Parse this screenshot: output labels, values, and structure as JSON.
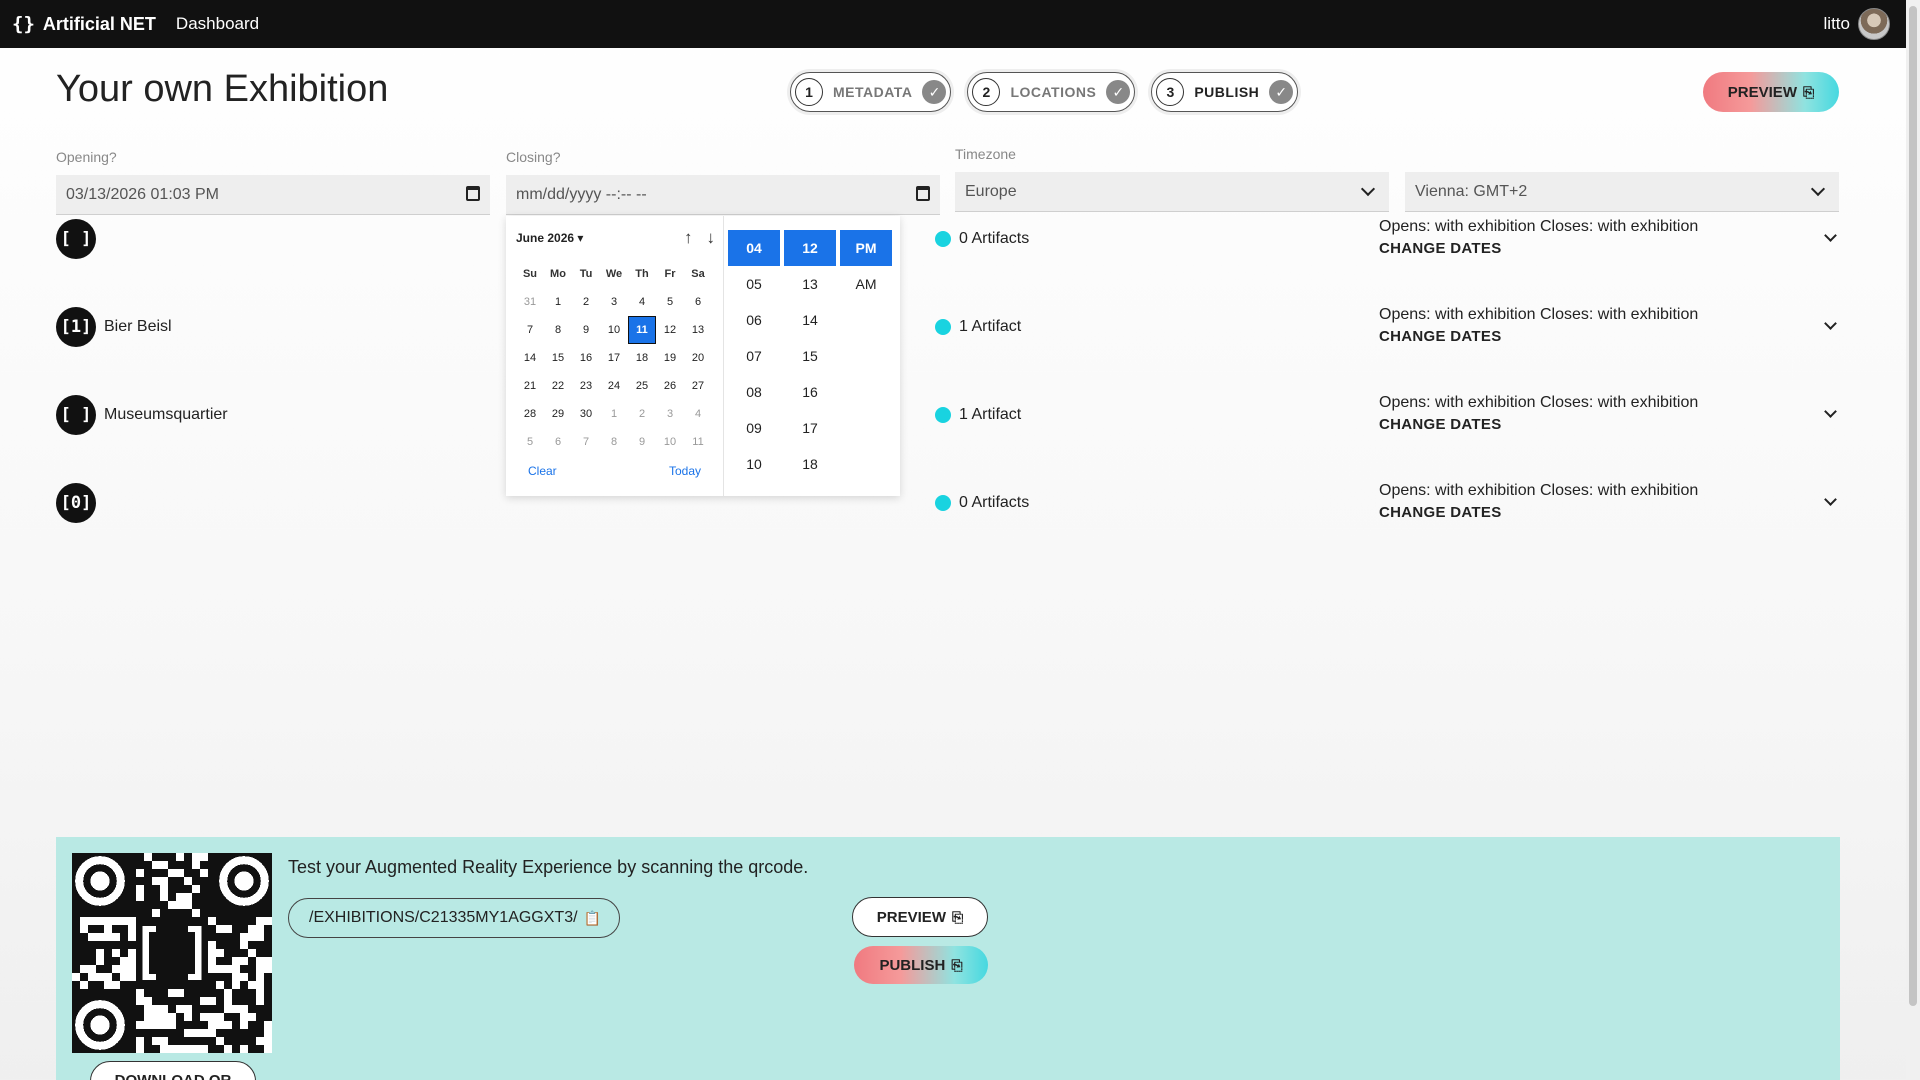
{
  "topbar": {
    "brand_logo": "{}",
    "brand_name": "Artificial NET",
    "nav_dashboard": "Dashboard",
    "username": "litto"
  },
  "page": {
    "title": "Your own Exhibition"
  },
  "stepper": [
    {
      "num": "1",
      "label": "METADATA"
    },
    {
      "num": "2",
      "label": "LOCATIONS"
    },
    {
      "num": "3",
      "label": "PUBLISH"
    }
  ],
  "preview_label": "PREVIEW",
  "opening": {
    "label": "Opening?",
    "value": "03/13/2026 01:03 PM"
  },
  "closing": {
    "label": "Closing?",
    "value": "mm/dd/yyyy --:-- --"
  },
  "timezone": {
    "label": "Timezone",
    "region": "Europe",
    "city": "Vienna: GMT+2"
  },
  "datepicker": {
    "month_label": "June 2026",
    "weekdays": [
      "Su",
      "Mo",
      "Tu",
      "We",
      "Th",
      "Fr",
      "Sa"
    ],
    "days": [
      "31",
      "1",
      "2",
      "3",
      "4",
      "5",
      "6",
      "7",
      "8",
      "9",
      "10",
      "11",
      "12",
      "13",
      "14",
      "15",
      "16",
      "17",
      "18",
      "19",
      "20",
      "21",
      "22",
      "23",
      "24",
      "25",
      "26",
      "27",
      "28",
      "29",
      "30",
      "1",
      "2",
      "3",
      "4",
      "5",
      "6",
      "7",
      "8",
      "9",
      "10",
      "11"
    ],
    "selected_day": "11",
    "clear": "Clear",
    "today": "Today",
    "hours": [
      "04",
      "05",
      "06",
      "07",
      "08",
      "09",
      "10"
    ],
    "minutes": [
      "12",
      "13",
      "14",
      "15",
      "16",
      "17",
      "18"
    ],
    "ampm": [
      "PM",
      "AM"
    ]
  },
  "locations": [
    {
      "icon": "[ ]",
      "name": "",
      "artifacts": "0 Artifacts",
      "dates": "Opens: with exhibition Closes: with exhibition",
      "change": "CHANGE DATES"
    },
    {
      "icon": "[1]",
      "name": "Bier Beisl",
      "artifacts": "1 Artifact",
      "dates": "Opens: with exhibition Closes: with exhibition",
      "change": "CHANGE DATES"
    },
    {
      "icon": "[ ]",
      "name": "Museumsquartier",
      "artifacts": "1 Artifact",
      "dates": "Opens: with exhibition Closes: with exhibition",
      "change": "CHANGE DATES"
    },
    {
      "icon": "[0]",
      "name": "",
      "artifacts": "0 Artifacts",
      "dates": "Opens: with exhibition Closes: with exhibition",
      "change": "CHANGE DATES"
    }
  ],
  "bottom": {
    "instruction": "Test your Augmented Reality Experience by scanning the qrcode.",
    "path": "/EXHIBITIONS/C21335MY1AGGXT3/",
    "preview": "PREVIEW",
    "publish": "PUBLISH",
    "download": "DOWNLOAD QR"
  },
  "colors": {
    "accent_blue": "#1a73e8",
    "artifact_dot": "#19d3e0",
    "panel_bg": "#b9e9e4",
    "topbar_bg": "#111111"
  }
}
